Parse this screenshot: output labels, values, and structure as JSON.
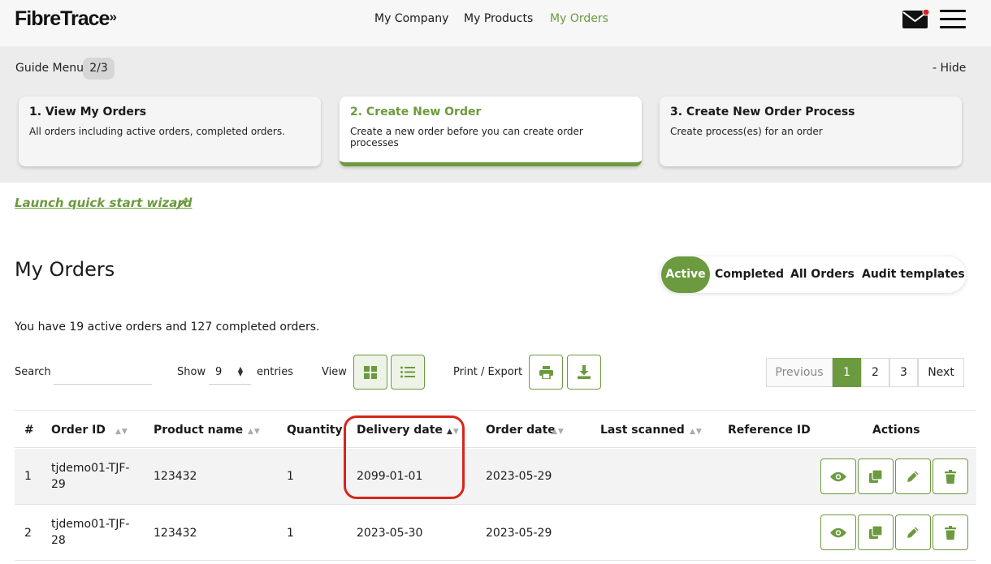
{
  "header": {
    "logo": "FibreTrace",
    "nav": [
      {
        "label": "My Company",
        "active": false
      },
      {
        "label": "My Products",
        "active": false
      },
      {
        "label": "My Orders",
        "active": true
      }
    ],
    "icons": [
      "mail-icon",
      "notification-dot",
      "hamburger-menu-icon"
    ]
  },
  "guide": {
    "title": "Guide Menu",
    "step_badge": "2/3",
    "hide_label": "- Hide",
    "cards": [
      {
        "title": "1. View My Orders",
        "description": "All orders including active orders, completed orders.",
        "active": false
      },
      {
        "title": "2. Create New Order",
        "description": "Create a new order before you can create order processes",
        "active": true
      },
      {
        "title": "3. Create New Order Process",
        "description": "Create process(es) for an order",
        "active": false
      }
    ]
  },
  "wizard_link": "Launch quick start wizard",
  "page_title": "My Orders",
  "tabs": [
    "Active",
    "Completed",
    "All Orders",
    "Audit templates"
  ],
  "active_tab": "Active",
  "summary": "You have 19 active orders and 127 completed orders.",
  "controls": {
    "search_label": "Search",
    "search_value": "",
    "show_label": "Show",
    "show_value": "9",
    "entries_label": "entries",
    "view_label": "View",
    "print_export_label": "Print / Export"
  },
  "pagination": {
    "previous": "Previous",
    "pages": [
      "1",
      "2",
      "3"
    ],
    "current": "1",
    "next": "Next"
  },
  "table": {
    "columns": [
      "#",
      "Order ID",
      "Product name",
      "Quantity",
      "Delivery date",
      "Order date",
      "Last scanned",
      "Reference ID",
      "Actions"
    ],
    "rows": [
      {
        "num": "1",
        "order_id": "tjdemo01-TJF-29",
        "product": "123432",
        "quantity": "1",
        "delivery": "2099-01-01",
        "order_date": "2023-05-29",
        "last_scanned": "",
        "reference": ""
      },
      {
        "num": "2",
        "order_id": "tjdemo01-TJF-28",
        "product": "123432",
        "quantity": "1",
        "delivery": "2023-05-30",
        "order_date": "2023-05-29",
        "last_scanned": "",
        "reference": ""
      }
    ],
    "row_actions": [
      "view-icon",
      "duplicate-icon",
      "edit-icon",
      "delete-icon"
    ]
  },
  "colors": {
    "accent": "#6c9a3e",
    "highlight": "#d6261b",
    "notification": "#e0201b"
  }
}
